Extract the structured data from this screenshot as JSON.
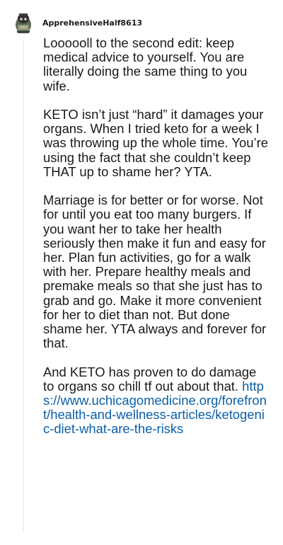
{
  "comment": {
    "username": "ApprehensiveHalf8613",
    "avatar_icon": "snoo-avatar-icon",
    "paragraphs": [
      "Loooooll to the second edit: keep medical advice to yourself. You are literally doing the same thing to you wife.",
      "KETO isn’t just “hard” it damages your organs. When I tried keto for a week I was throwing up the whole time. You’re using the fact that she couldn’t keep THAT up to shame her? YTA.",
      "Marriage is for better or for worse. Not for until you eat too many burgers. If you want her to take her health seriously then make it fun and easy for her. Plan fun activities, go for a walk with her. Prepare healthy meals and premake meals so that she just has to grab and go. Make it more convenient for her to diet than not. But done shame her. YTA always and forever for that.",
      "And KETO has proven to do damage to organs so chill tf out about that."
    ],
    "link": "https://www.uchicagomedicine.org/forefront/health-and-wellness-articles/ketogenic-diet-what-are-the-risks"
  },
  "colors": {
    "text": "#1a1a1b",
    "link": "#0b5fa5",
    "thread_line": "#e6e6e6"
  }
}
